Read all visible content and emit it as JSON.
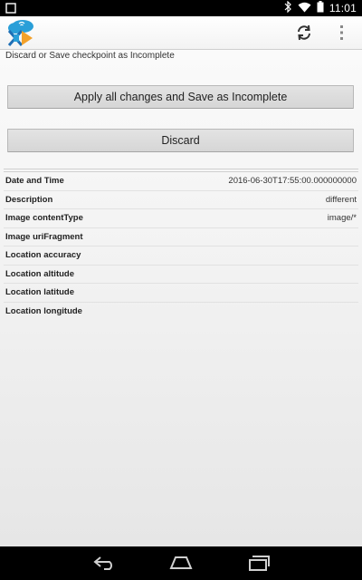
{
  "status_bar": {
    "clock": "11:01",
    "icons": [
      "notification-icon",
      "bluetooth-icon",
      "wifi-icon",
      "battery-icon"
    ]
  },
  "action_bar": {
    "logo": "app-logo",
    "actions": [
      "sync-icon",
      "overflow-menu-icon"
    ]
  },
  "page": {
    "subtitle": "Discard or Save checkpoint as Incomplete",
    "apply_button_label": "Apply all changes and Save as Incomplete",
    "discard_button_label": "Discard"
  },
  "fields": [
    {
      "label": "Date and Time",
      "value": "2016-06-30T17:55:00.000000000"
    },
    {
      "label": "Description",
      "value": "different"
    },
    {
      "label": "Image contentType",
      "value": "image/*"
    },
    {
      "label": "Image uriFragment",
      "value": ""
    },
    {
      "label": "Location accuracy",
      "value": ""
    },
    {
      "label": "Location altitude",
      "value": ""
    },
    {
      "label": "Location latitude",
      "value": ""
    },
    {
      "label": "Location longitude",
      "value": ""
    }
  ],
  "nav_bar": {
    "buttons": [
      "back-icon",
      "home-icon",
      "recents-icon"
    ]
  },
  "colors": {
    "status_bar_bg": "#000000",
    "button_bg": "#dcdcdc",
    "content_bg": "#f2f2f2"
  }
}
